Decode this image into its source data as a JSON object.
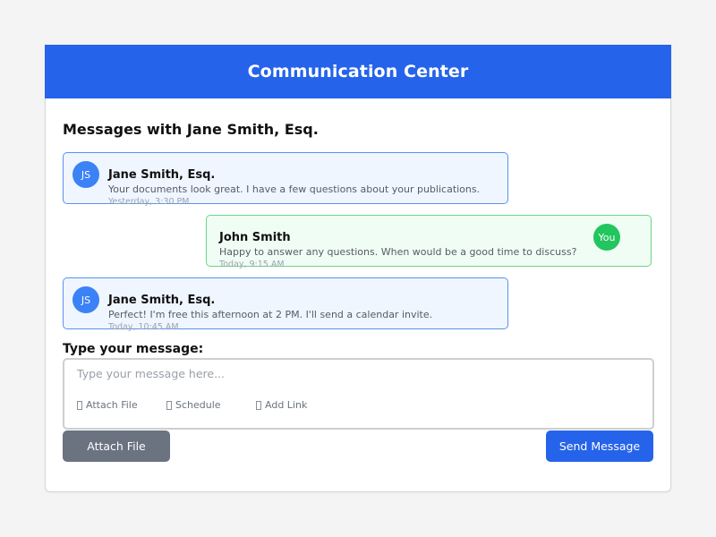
{
  "header": {
    "title": "Communication Center"
  },
  "conversation": {
    "title": "Messages with Jane Smith, Esq."
  },
  "messages": [
    {
      "avatar": "JS",
      "sender": "Jane Smith, Esq.",
      "text": "Your documents look great. I have a few questions about your publications.",
      "time": "Yesterday, 3:30 PM"
    },
    {
      "avatar": "You",
      "sender": "John Smith",
      "text": "Happy to answer any questions. When would be a good time to discuss?",
      "time": "Today, 9:15 AM"
    },
    {
      "avatar": "JS",
      "sender": "Jane Smith, Esq.",
      "text": "Perfect! I'm free this afternoon at 2 PM. I'll send a calendar invite.",
      "time": "Today, 10:45 AM"
    }
  ],
  "compose": {
    "label": "Type your message:",
    "placeholder": "Type your message here...",
    "tools": [
      {
        "label": "Attach File",
        "icon": "attach-file-icon"
      },
      {
        "label": "Schedule",
        "icon": "schedule-icon"
      },
      {
        "label": "Add Link",
        "icon": "add-link-icon"
      }
    ]
  },
  "actions": {
    "attach_label": "Attach File",
    "send_label": "Send Message"
  },
  "colors": {
    "primary": "#2563eb",
    "incoming_bg": "#eff6ff",
    "incoming_border": "#5b93ea",
    "outgoing_bg": "#f0fdf4",
    "outgoing_border": "#6ed58b",
    "avatar_them": "#3b82f6",
    "avatar_me": "#22c55e",
    "secondary_button": "#6b7280"
  }
}
